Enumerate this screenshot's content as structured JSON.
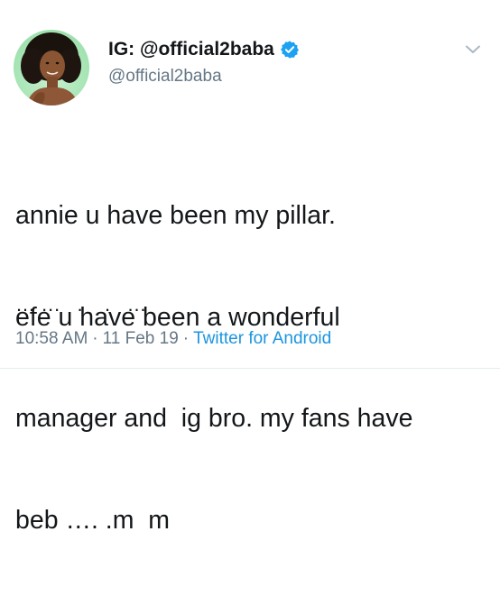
{
  "author": {
    "display_name": "IG: @official2baba",
    "handle": "@official2baba",
    "verified": true,
    "avatar_icon": "profile-photo-icon",
    "verified_icon": "verified-badge-icon"
  },
  "menu": {
    "icon": "chevron-down-icon"
  },
  "tweet": {
    "lines": [
      "annie u have been my pillar.",
      "efe u have been a wonderful",
      "manager and  ig bro. my fans have",
      "beb …. .m  m"
    ],
    "trailing_dots": "… …   .    .   …"
  },
  "meta": {
    "time": "10:58 AM",
    "separator": "·",
    "date": "11 Feb 19",
    "source": "Twitter for Android"
  },
  "colors": {
    "text": "#14171a",
    "secondary": "#657786",
    "link": "#1b95e0",
    "verified": "#1da1f2"
  }
}
